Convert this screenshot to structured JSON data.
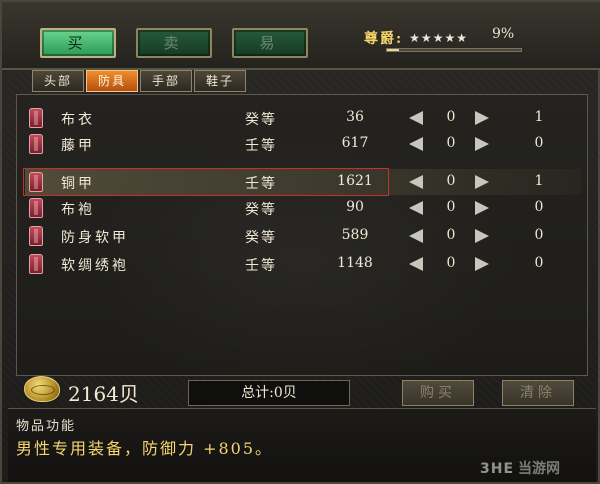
{
  "trade_modes": {
    "buy": "买",
    "sell": "卖",
    "exchange": "易"
  },
  "rank": {
    "label": "尊爵:",
    "stars": "★★★★★",
    "progress_text": "9%",
    "progress": 0.09
  },
  "categories": {
    "head": "头部",
    "armor": "防具",
    "hand": "手部",
    "shoes": "鞋子",
    "active": "armor"
  },
  "items": [
    {
      "name": "布衣",
      "grade": "癸等",
      "price": "36",
      "qty": "0",
      "owned": "1"
    },
    {
      "name": "藤甲",
      "grade": "壬等",
      "price": "617",
      "qty": "0",
      "owned": "0"
    },
    {
      "name": "铜甲",
      "grade": "壬等",
      "price": "1621",
      "qty": "0",
      "owned": "1"
    },
    {
      "name": "布袍",
      "grade": "癸等",
      "price": "90",
      "qty": "0",
      "owned": "0"
    },
    {
      "name": "防身软甲",
      "grade": "癸等",
      "price": "589",
      "qty": "0",
      "owned": "0"
    },
    {
      "name": "软绸绣袍",
      "grade": "壬等",
      "price": "1148",
      "qty": "0",
      "owned": "0"
    }
  ],
  "selected_index": 2,
  "wallet": {
    "amount": "2164贝",
    "icon": "coin-icon"
  },
  "total": "总计:0贝",
  "actions": {
    "purchase": "购买",
    "clear": "清除"
  },
  "description": {
    "title": "物品功能",
    "text": "男性专用装备，防御力 +805。"
  },
  "watermark": {
    "logo": "3HE",
    "text": "当游网"
  },
  "colors": {
    "accent_gold": "#f5d56c",
    "tab_active": "#f08d2c",
    "select_border": "#c2312a",
    "buy_green": "#6ad48f"
  }
}
